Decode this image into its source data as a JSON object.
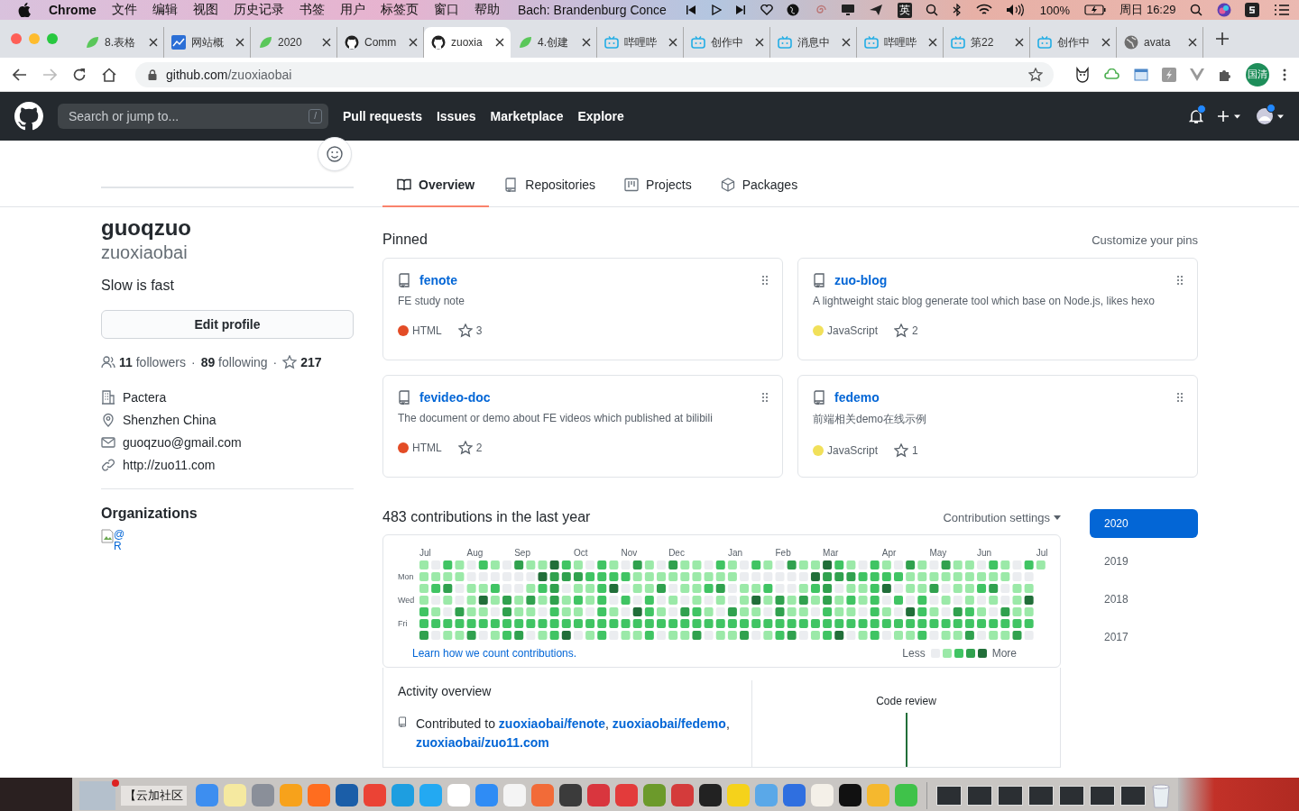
{
  "menubar": {
    "app": "Chrome",
    "menus": [
      "文件",
      "编辑",
      "视图",
      "历史记录",
      "书签",
      "用户",
      "标签页",
      "窗口",
      "帮助"
    ],
    "now_playing": "Bach: Brandenburg Conce",
    "input_method": "英",
    "battery": "100%",
    "clock": "周日 16:29"
  },
  "browser": {
    "tabs": [
      {
        "title": "8.表格",
        "selected": false
      },
      {
        "title": "网站概",
        "selected": false
      },
      {
        "title": "2020",
        "selected": false
      },
      {
        "title": "Comm",
        "selected": false
      },
      {
        "title": "zuoxia",
        "selected": true
      },
      {
        "title": "4.创建",
        "selected": false
      },
      {
        "title": "哔哩哔",
        "selected": false
      },
      {
        "title": "创作中",
        "selected": false
      },
      {
        "title": "消息中",
        "selected": false
      },
      {
        "title": "哔哩哔",
        "selected": false
      },
      {
        "title": "第22",
        "selected": false
      },
      {
        "title": "创作中",
        "selected": false
      },
      {
        "title": "avata",
        "selected": false
      }
    ],
    "host": "github.com",
    "path": "/zuoxiaobai",
    "profile_badge": "国清"
  },
  "header": {
    "search_placeholder": "Search or jump to...",
    "search_key": "/",
    "nav": [
      "Pull requests",
      "Issues",
      "Marketplace",
      "Explore"
    ]
  },
  "profile": {
    "name": "guoqzuo",
    "login": "zuoxiaobai",
    "bio": "Slow is fast",
    "edit_button": "Edit profile",
    "separator": "·",
    "followers": "11",
    "followers_label": "followers",
    "following": "89",
    "following_label": "following",
    "stars": "217",
    "details": [
      {
        "kind": "company",
        "text": "Pactera"
      },
      {
        "kind": "location",
        "text": "Shenzhen China"
      },
      {
        "kind": "email",
        "text": "guoqzuo@gmail.com"
      },
      {
        "kind": "link",
        "text": "http://zuo11.com"
      }
    ],
    "organizations_title": "Organizations",
    "org_alt": "@R"
  },
  "tabs": [
    {
      "label": "Overview",
      "selected": true
    },
    {
      "label": "Repositories",
      "selected": false
    },
    {
      "label": "Projects",
      "selected": false
    },
    {
      "label": "Packages",
      "selected": false
    }
  ],
  "pinned": {
    "title": "Pinned",
    "customize": "Customize your pins",
    "repos": [
      {
        "name": "fenote",
        "description": "FE study note",
        "language": "HTML",
        "color": "#e34c26",
        "stars": "3"
      },
      {
        "name": "zuo-blog",
        "description": "A lightweight staic blog generate tool which base on Node.js, likes hexo",
        "language": "JavaScript",
        "color": "#f1e05a",
        "stars": "2"
      },
      {
        "name": "fevideo-doc",
        "description": "The document or demo about FE videos which published at bilibili",
        "language": "HTML",
        "color": "#e34c26",
        "stars": "2"
      },
      {
        "name": "fedemo",
        "description": "前端相关demo在线示例",
        "language": "JavaScript",
        "color": "#f1e05a",
        "stars": "1"
      }
    ]
  },
  "contributions": {
    "title": "483 contributions in the last year",
    "settings": "Contribution settings",
    "months": [
      "Jul",
      "Aug",
      "Sep",
      "Oct",
      "Nov",
      "Dec",
      "Jan",
      "Feb",
      "Mar",
      "Apr",
      "May",
      "Jun",
      "Jul"
    ],
    "days": [
      "Mon",
      "Wed",
      "Fri"
    ],
    "learn_link": "Learn how we count contributions.",
    "less": "Less",
    "more": "More",
    "years": [
      {
        "label": "2020",
        "selected": true
      },
      {
        "label": "2019",
        "selected": false
      },
      {
        "label": "2018",
        "selected": false
      },
      {
        "label": "2017",
        "selected": false
      }
    ]
  },
  "activity": {
    "title": "Activity overview",
    "prefix": "Contributed to ",
    "separator": ",",
    "repos": [
      "zuoxiaobai/fenote",
      "zuoxiaobai/fedemo",
      "zuoxiaobai/zuo11.com"
    ],
    "axis_label": "Code review"
  },
  "dock": {
    "window_title": "【云加社区"
  }
}
